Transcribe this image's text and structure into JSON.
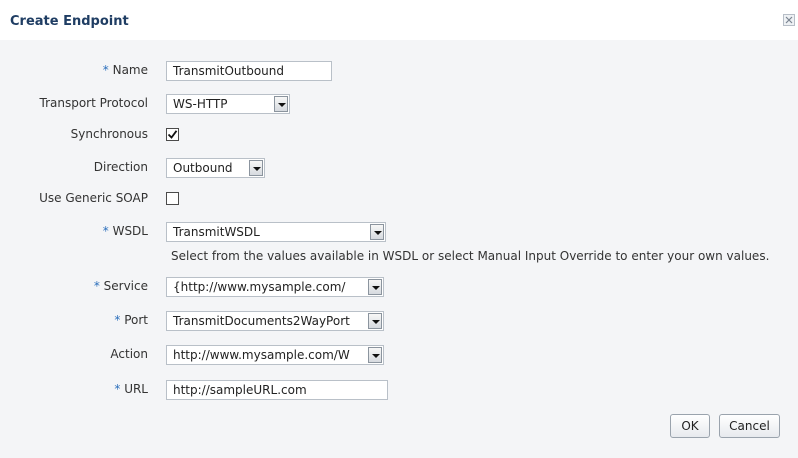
{
  "dialog": {
    "title": "Create Endpoint"
  },
  "form": {
    "name": {
      "label": "Name",
      "required": true,
      "value": "TransmitOutbound"
    },
    "transport_protocol": {
      "label": "Transport Protocol",
      "value": "WS-HTTP"
    },
    "synchronous": {
      "label": "Synchronous",
      "checked": true
    },
    "direction": {
      "label": "Direction",
      "value": "Outbound"
    },
    "use_generic_soap": {
      "label": "Use Generic SOAP",
      "checked": false
    },
    "wsdl": {
      "label": "WSDL",
      "required": true,
      "value": "TransmitWSDL"
    },
    "help_text": "Select from the values available in WSDL or select Manual Input Override to enter your own values.",
    "service": {
      "label": "Service",
      "required": true,
      "value": "{http://www.mysample.com/"
    },
    "port": {
      "label": "Port",
      "required": true,
      "value": "TransmitDocuments2WayPort"
    },
    "action": {
      "label": "Action",
      "value": "http://www.mysample.com/W"
    },
    "url": {
      "label": "URL",
      "required": true,
      "value": "http://sampleURL.com"
    }
  },
  "buttons": {
    "ok": "OK",
    "cancel": "Cancel"
  },
  "required_marker": "*"
}
